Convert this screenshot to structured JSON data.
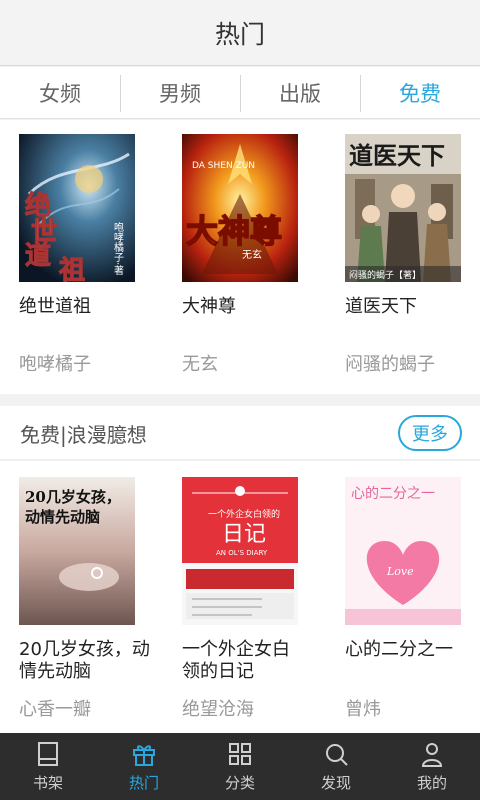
{
  "header": {
    "title": "热门"
  },
  "tabs": [
    {
      "label": "女频",
      "active": false
    },
    {
      "label": "男频",
      "active": false
    },
    {
      "label": "出版",
      "active": false
    },
    {
      "label": "免费",
      "active": true
    }
  ],
  "featured": {
    "books": [
      {
        "title": "绝世道祖",
        "author": "咆哮橘子",
        "cover_text": "绝世道祖",
        "cover_sub": "咆哮橘子·著"
      },
      {
        "title": "大神尊",
        "author": "无玄",
        "cover_text": "大神尊",
        "cover_sub": "DA SHEN ZUN"
      },
      {
        "title": "道医天下",
        "author": "闷骚的蝎子",
        "cover_text": "道医天下",
        "cover_sub": "闷骚的蝎子【著】"
      }
    ]
  },
  "section2": {
    "title": "免费|浪漫臆想",
    "more_label": "更多",
    "books": [
      {
        "title": "20几岁女孩，动情先动脑",
        "author": "心香一瓣",
        "cover_text": "20几岁女孩，动情先动脑"
      },
      {
        "title": "一个外企女白领的日记",
        "author": "绝望沧海",
        "cover_text": "日记",
        "cover_sub": "一个外企女白领的",
        "cover_sub2": "AN OL'S DIARY"
      },
      {
        "title": "心的二分之一",
        "author": "曾炜",
        "cover_text": "心的二分之一",
        "cover_sub": "Love"
      }
    ]
  },
  "bottom_nav": [
    {
      "label": "书架",
      "icon": "bookshelf-icon",
      "active": false
    },
    {
      "label": "热门",
      "icon": "gift-icon",
      "active": true
    },
    {
      "label": "分类",
      "icon": "grid-icon",
      "active": false
    },
    {
      "label": "发现",
      "icon": "search-icon",
      "active": false
    },
    {
      "label": "我的",
      "icon": "user-icon",
      "active": false
    }
  ],
  "colors": {
    "accent": "#29a7df",
    "nav_bg": "#2d2d2d"
  }
}
